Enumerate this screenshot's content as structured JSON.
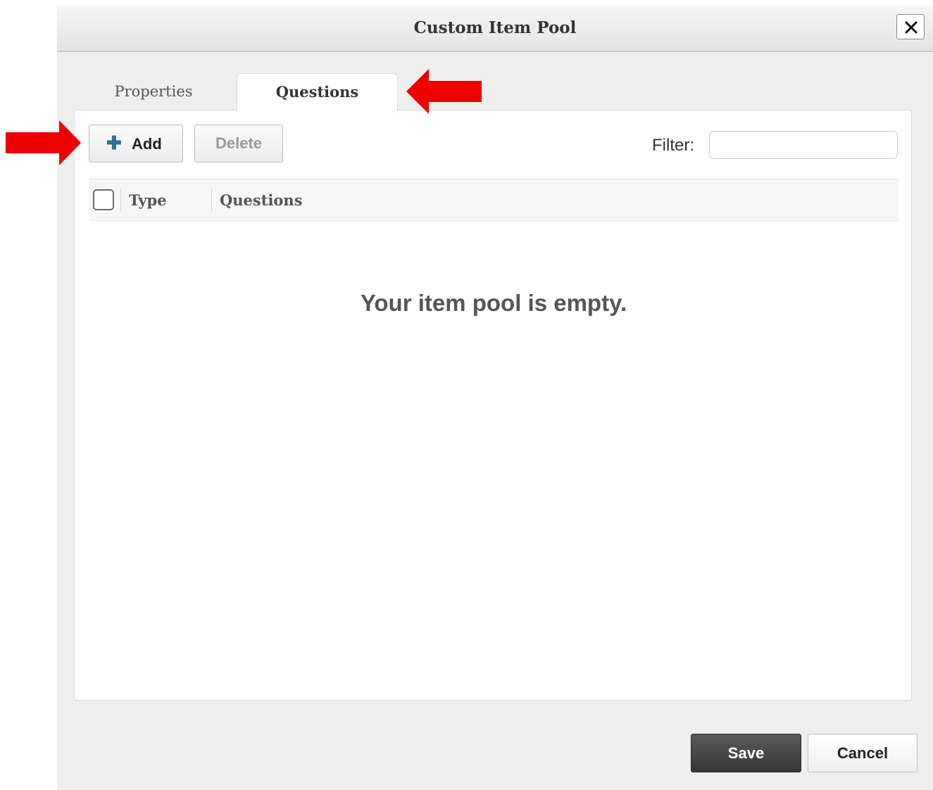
{
  "dialog": {
    "title": "Custom Item Pool",
    "close_icon": "close-icon"
  },
  "tabs": [
    {
      "label": "Properties",
      "active": false
    },
    {
      "label": "Questions",
      "active": true
    }
  ],
  "toolbar": {
    "add_label": "Add",
    "add_icon": "plus-icon",
    "delete_label": "Delete",
    "delete_enabled": false,
    "filter_label": "Filter:",
    "filter_value": ""
  },
  "table": {
    "columns": [
      "Type",
      "Questions"
    ],
    "empty_message": "Your item pool is empty."
  },
  "footer": {
    "save_label": "Save",
    "cancel_label": "Cancel"
  },
  "annotations": {
    "arrow_color": "#ee0000",
    "arrow_icon": "red-arrow-icon"
  }
}
